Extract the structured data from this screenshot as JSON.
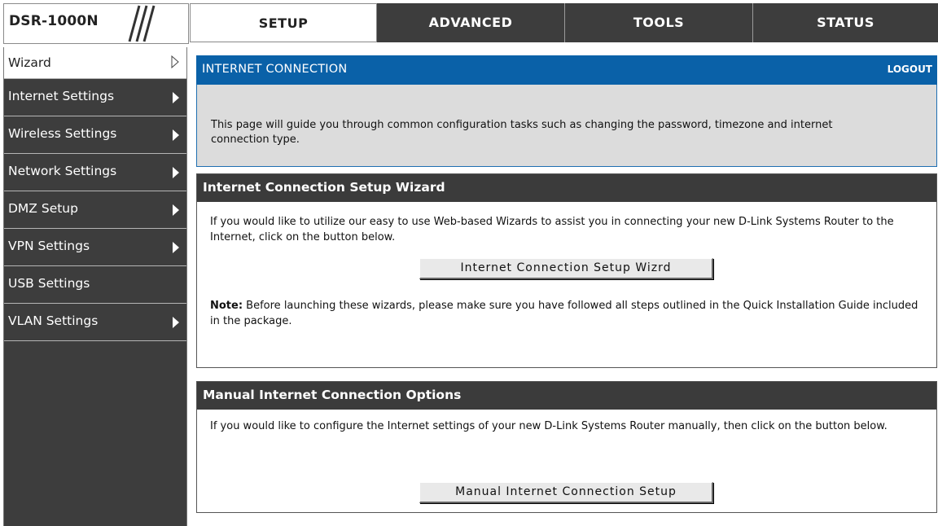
{
  "header": {
    "model": "DSR-1000N",
    "tabs": [
      {
        "label": "SETUP",
        "active": true
      },
      {
        "label": "ADVANCED",
        "active": false
      },
      {
        "label": "TOOLS",
        "active": false
      },
      {
        "label": "STATUS",
        "active": false
      }
    ]
  },
  "sidebar": {
    "items": [
      {
        "label": "Wizard",
        "active": true
      },
      {
        "label": "Internet Settings",
        "has_arrow": true
      },
      {
        "label": "Wireless Settings",
        "has_arrow": true
      },
      {
        "label": "Network Settings",
        "has_arrow": true
      },
      {
        "label": "DMZ Setup",
        "has_arrow": true
      },
      {
        "label": "VPN Settings",
        "has_arrow": true
      },
      {
        "label": "USB Settings",
        "has_arrow": false
      },
      {
        "label": "VLAN Settings",
        "has_arrow": true
      }
    ]
  },
  "main": {
    "title": "INTERNET CONNECTION",
    "logout_label": "LOGOUT",
    "description": "This page will guide you through common configuration tasks such as changing the password, timezone and internet connection type.",
    "wizard_section": {
      "title": "Internet Connection Setup Wizard",
      "text": "If you would like to utilize our easy to use Web-based Wizards to assist you in connecting your new D-Link Systems Router to the Internet, click on the button below.",
      "button_label": "Internet Connection Setup Wizrd",
      "note_label": "Note:",
      "note_text": " Before launching these wizards, please make sure you have followed all steps outlined in the Quick Installation Guide included in the package."
    },
    "manual_section": {
      "title": "Manual Internet Connection Options",
      "text": "If you would like to configure the Internet settings of your new D-Link Systems Router manually, then click on the button below.",
      "button_label": "Manual Internet Connection Setup"
    }
  },
  "colors": {
    "header_blue": "#0a61a8",
    "dark_nav": "#3d3d3d",
    "section_head": "#3b3b3b",
    "desc_bg": "#dcdcdc"
  },
  "icons": {
    "model_decoration": "triple-slash-icon",
    "submenu": "triangle-right-icon",
    "active_submenu": "triangle-right-outline-icon"
  }
}
